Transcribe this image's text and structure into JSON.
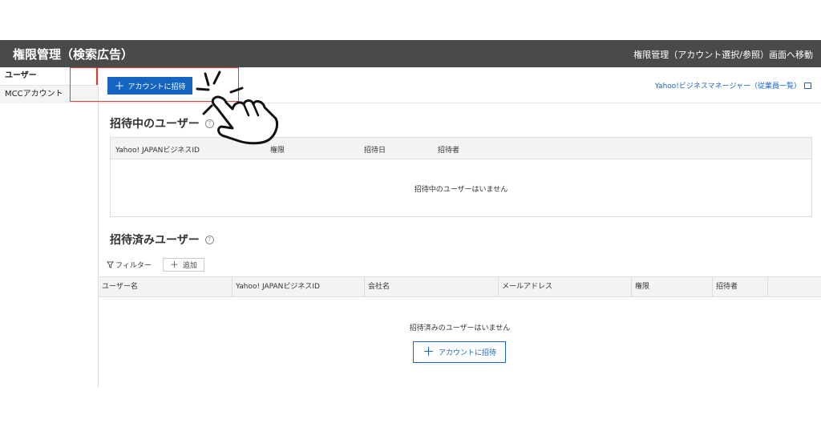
{
  "header": {
    "title": "権限管理（検索広告）",
    "right_link": "権限管理（アカウント選択/参照）画面へ移動"
  },
  "sidebar": {
    "items": [
      {
        "label": "ユーザー"
      },
      {
        "label": "MCCアカウント"
      }
    ]
  },
  "toolbar": {
    "invite_button": "アカウントに招待",
    "business_manager_link": "Yahoo!ビジネスマネージャー（従業員一覧）"
  },
  "pending": {
    "title": "招待中のユーザー",
    "columns": [
      "Yahoo! JAPANビジネスID",
      "権限",
      "招待日",
      "招待者"
    ],
    "empty_message": "招待中のユーザーはいません"
  },
  "invited": {
    "title": "招待済みユーザー",
    "filter_label": "フィルター",
    "add_label": "追加",
    "columns": [
      "ユーザー名",
      "Yahoo! JAPANビジネスID",
      "会社名",
      "メールアドレス",
      "権限",
      "招待者"
    ],
    "empty_message": "招待済みのユーザーはいません",
    "invite_button": "アカウントに招待"
  },
  "icons": {
    "help": "question-circle-icon",
    "filter": "funnel-icon",
    "plus": "plus-icon",
    "external": "external-link-icon",
    "pointer": "pointing-hand-icon"
  },
  "colors": {
    "header_bg": "#4a4a4a",
    "primary": "#1565c0",
    "link": "#1a66c4",
    "highlight": "#e53935"
  }
}
